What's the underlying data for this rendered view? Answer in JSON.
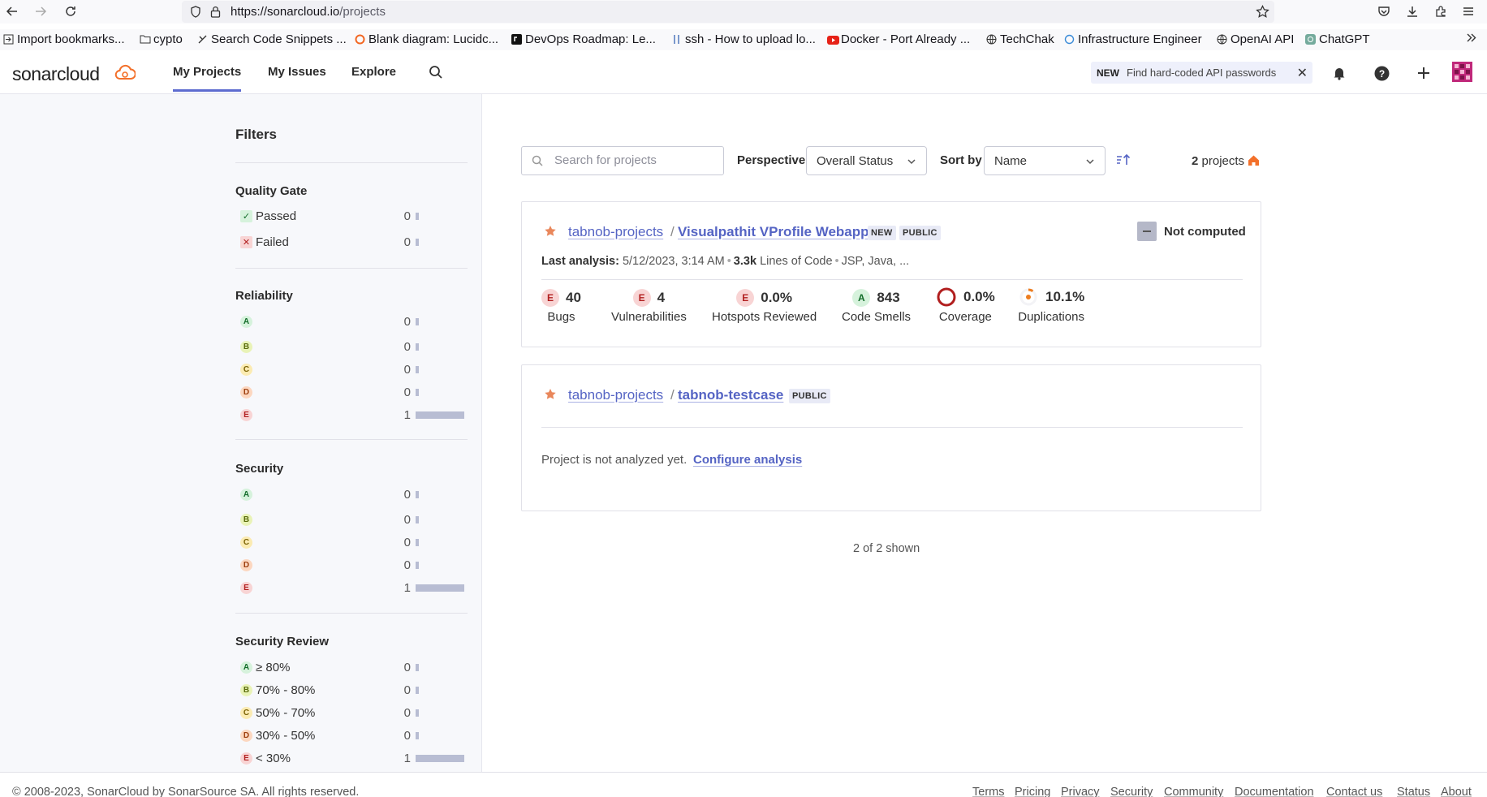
{
  "browser": {
    "url_host": "https://sonarcloud.io",
    "url_path": "/projects",
    "bookmarks": [
      {
        "label": "Import bookmarks..."
      },
      {
        "label": "cypto"
      },
      {
        "label": "Search Code Snippets ..."
      },
      {
        "label": "Blank diagram: Lucidc..."
      },
      {
        "label": "DevOps Roadmap: Le..."
      },
      {
        "label": "ssh - How to upload lo..."
      },
      {
        "label": "Docker - Port Already ..."
      },
      {
        "label": "TechChak"
      },
      {
        "label": "Infrastructure Engineer"
      },
      {
        "label": "OpenAI API"
      },
      {
        "label": "ChatGPT"
      }
    ]
  },
  "header": {
    "logo_text_regular": "sonar",
    "logo_text_bold": "cloud",
    "nav": [
      {
        "label": "My Projects",
        "active": true
      },
      {
        "label": "My Issues",
        "active": false
      },
      {
        "label": "Explore",
        "active": false
      }
    ],
    "promo": {
      "tag": "NEW",
      "text": "Find hard-coded API passwords",
      "close": "✕"
    }
  },
  "filters": {
    "title": "Filters",
    "quality_gate": {
      "title": "Quality Gate",
      "items": [
        {
          "label": "Passed",
          "count": "0",
          "icon": "check"
        },
        {
          "label": "Failed",
          "count": "0",
          "icon": "x"
        }
      ]
    },
    "reliability": {
      "title": "Reliability",
      "items": [
        {
          "grade": "A",
          "count": "0",
          "fill": 0
        },
        {
          "grade": "B",
          "count": "0",
          "fill": 0
        },
        {
          "grade": "C",
          "count": "0",
          "fill": 0
        },
        {
          "grade": "D",
          "count": "0",
          "fill": 0
        },
        {
          "grade": "E",
          "count": "1",
          "fill": 1
        }
      ]
    },
    "security": {
      "title": "Security",
      "items": [
        {
          "grade": "A",
          "count": "0",
          "fill": 0
        },
        {
          "grade": "B",
          "count": "0",
          "fill": 0
        },
        {
          "grade": "C",
          "count": "0",
          "fill": 0
        },
        {
          "grade": "D",
          "count": "0",
          "fill": 0
        },
        {
          "grade": "E",
          "count": "1",
          "fill": 1
        }
      ]
    },
    "security_review": {
      "title": "Security Review",
      "items": [
        {
          "grade": "A",
          "label": "≥ 80%",
          "count": "0",
          "fill": 0
        },
        {
          "grade": "B",
          "label": "70% - 80%",
          "count": "0",
          "fill": 0
        },
        {
          "grade": "C",
          "label": "50% - 70%",
          "count": "0",
          "fill": 0
        },
        {
          "grade": "D",
          "label": "30% - 50%",
          "count": "0",
          "fill": 0
        },
        {
          "grade": "E",
          "label": "< 30%",
          "count": "1",
          "fill": 1
        }
      ]
    }
  },
  "toolbar": {
    "search_placeholder": "Search for projects",
    "perspective_label": "Perspective",
    "perspective_value": "Overall Status",
    "sort_label": "Sort by",
    "sort_value": "Name",
    "count_number": "2",
    "count_label": "projects"
  },
  "projects": [
    {
      "org": "tabnob-projects",
      "separator": "/",
      "name": "Visualpathit VProfile Webapp",
      "badges": [
        "NEW",
        "PUBLIC"
      ],
      "quality_gate": "Not computed",
      "last_analysis_label": "Last analysis:",
      "last_analysis_value": "5/12/2023, 3:14 AM",
      "loc_value": "3.3k",
      "loc_label": "Lines of Code",
      "languages": "JSP, Java, ...",
      "metrics": [
        {
          "grade": "E",
          "value": "40",
          "label": "Bugs"
        },
        {
          "grade": "E",
          "value": "4",
          "label": "Vulnerabilities"
        },
        {
          "grade": "E",
          "value": "0.0%",
          "label": "Hotspots Reviewed"
        },
        {
          "grade": "A",
          "value": "843",
          "label": "Code Smells"
        },
        {
          "value": "0.0%",
          "label": "Coverage",
          "fraction": 0.0
        },
        {
          "value": "10.1%",
          "label": "Duplications",
          "fraction": 0.101
        }
      ]
    },
    {
      "org": "tabnob-projects",
      "separator": "/",
      "name": "tabnob-testcase",
      "badges": [
        "PUBLIC"
      ],
      "status_text": "Project is not analyzed yet.",
      "action": "Configure analysis"
    }
  ],
  "list_footer": "2 of 2 shown",
  "footer": {
    "copyright": "© 2008-2023, SonarCloud by SonarSource SA. All rights reserved.",
    "links": [
      "Terms",
      "Pricing",
      "Privacy",
      "Security",
      "Community",
      "Documentation",
      "Contact us",
      "Status",
      "About"
    ]
  },
  "colors": {
    "accent": "#5d6cd0",
    "link": "#5564c4",
    "star": "#e9875b",
    "coverage_ring": "#b11e1e",
    "duplications_ring": "#ed7d20"
  }
}
